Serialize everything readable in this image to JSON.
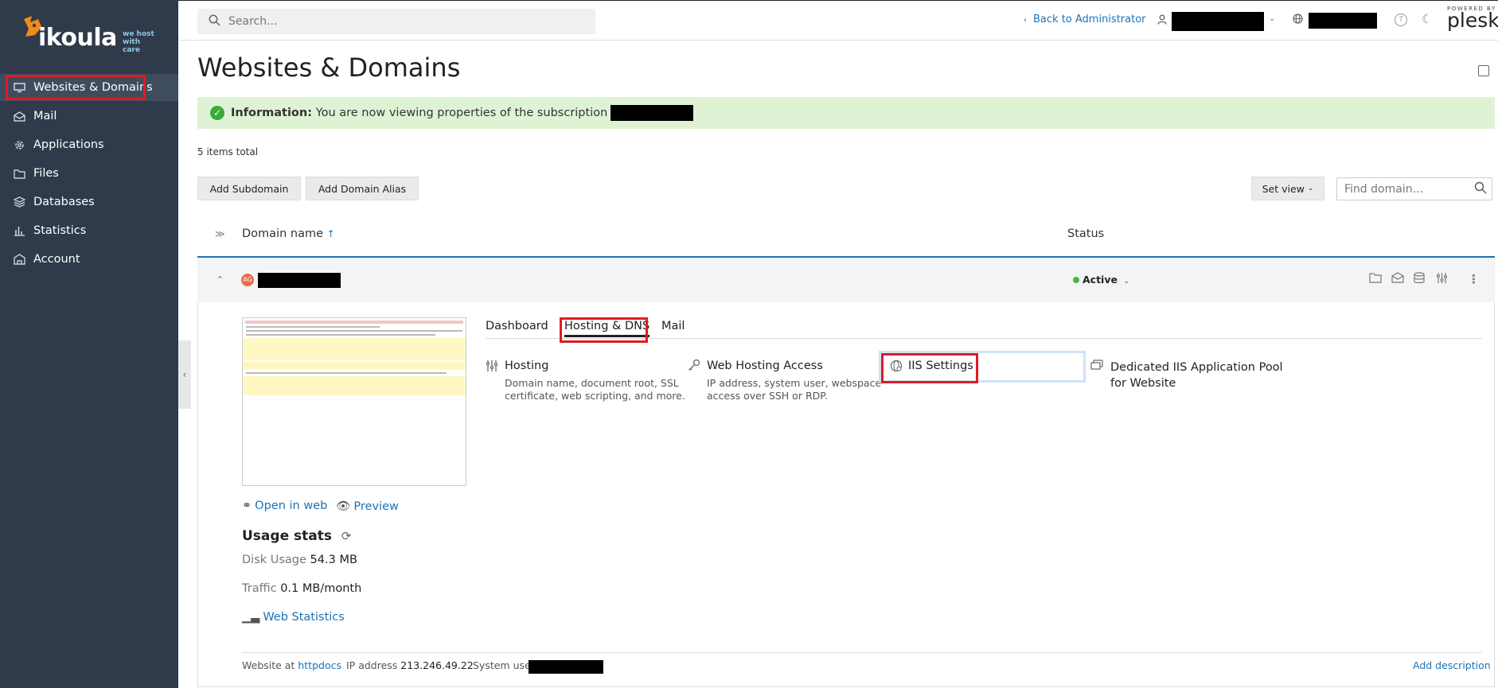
{
  "logo": {
    "name": "ikoula",
    "tagline_1": "we host",
    "tagline_2": "with care"
  },
  "sidebar": {
    "items": [
      {
        "label": "Websites & Domains",
        "icon": "monitor-icon"
      },
      {
        "label": "Mail",
        "icon": "mail-icon"
      },
      {
        "label": "Applications",
        "icon": "gear-icon"
      },
      {
        "label": "Files",
        "icon": "folder-icon"
      },
      {
        "label": "Databases",
        "icon": "database-icon"
      },
      {
        "label": "Statistics",
        "icon": "bar-chart-icon"
      },
      {
        "label": "Account",
        "icon": "account-icon"
      }
    ]
  },
  "topbar": {
    "search_placeholder": "Search...",
    "back_link": "Back to Administrator",
    "powered_by": "POWERED BY",
    "brand": "plesk"
  },
  "main": {
    "title": "Websites & Domains",
    "info": {
      "label": "Information:",
      "text": "You are now viewing properties of the subscription"
    },
    "items_total": "5 items total",
    "buttons": {
      "add_subdomain": "Add Subdomain",
      "add_alias": "Add Domain Alias",
      "set_view": "Set view"
    },
    "find_placeholder": "Find domain...",
    "table": {
      "col_domain": "Domain name",
      "col_status": "Status"
    },
    "row": {
      "status": "Active",
      "tabs": [
        "Dashboard",
        "Hosting & DNS",
        "Mail"
      ],
      "tools": [
        {
          "title": "Hosting",
          "desc_1": "Domain name, document root, SSL",
          "desc_2": "certificate, web scripting, and more."
        },
        {
          "title": "Web Hosting Access",
          "desc_1": "IP address, system user, webspace",
          "desc_2": "access over SSH or RDP."
        },
        {
          "title": "IIS Settings"
        },
        {
          "title": "Dedicated IIS Application Pool",
          "title_2": "for Website"
        }
      ],
      "links": {
        "open_in_web": "Open in web",
        "preview": "Preview",
        "web_statistics": "Web Statistics"
      },
      "usage": {
        "title": "Usage stats",
        "disk_label": "Disk Usage",
        "disk_value": "54.3 MB",
        "traffic_label": "Traffic",
        "traffic_value": "0.1 MB/month"
      },
      "footer": {
        "website_at": "Website at",
        "docroot": "httpdocs",
        "ip_label": "IP address",
        "ip_value": "213.246.49.22",
        "sysuser_label": "System user",
        "add_description": "Add description"
      }
    }
  },
  "colors": {
    "sidebar_bg": "#2f3b4b",
    "accent": "#1a73b8",
    "highlight": "#e01b24",
    "info_bg": "#dff3d4",
    "active_dot": "#46b546"
  }
}
